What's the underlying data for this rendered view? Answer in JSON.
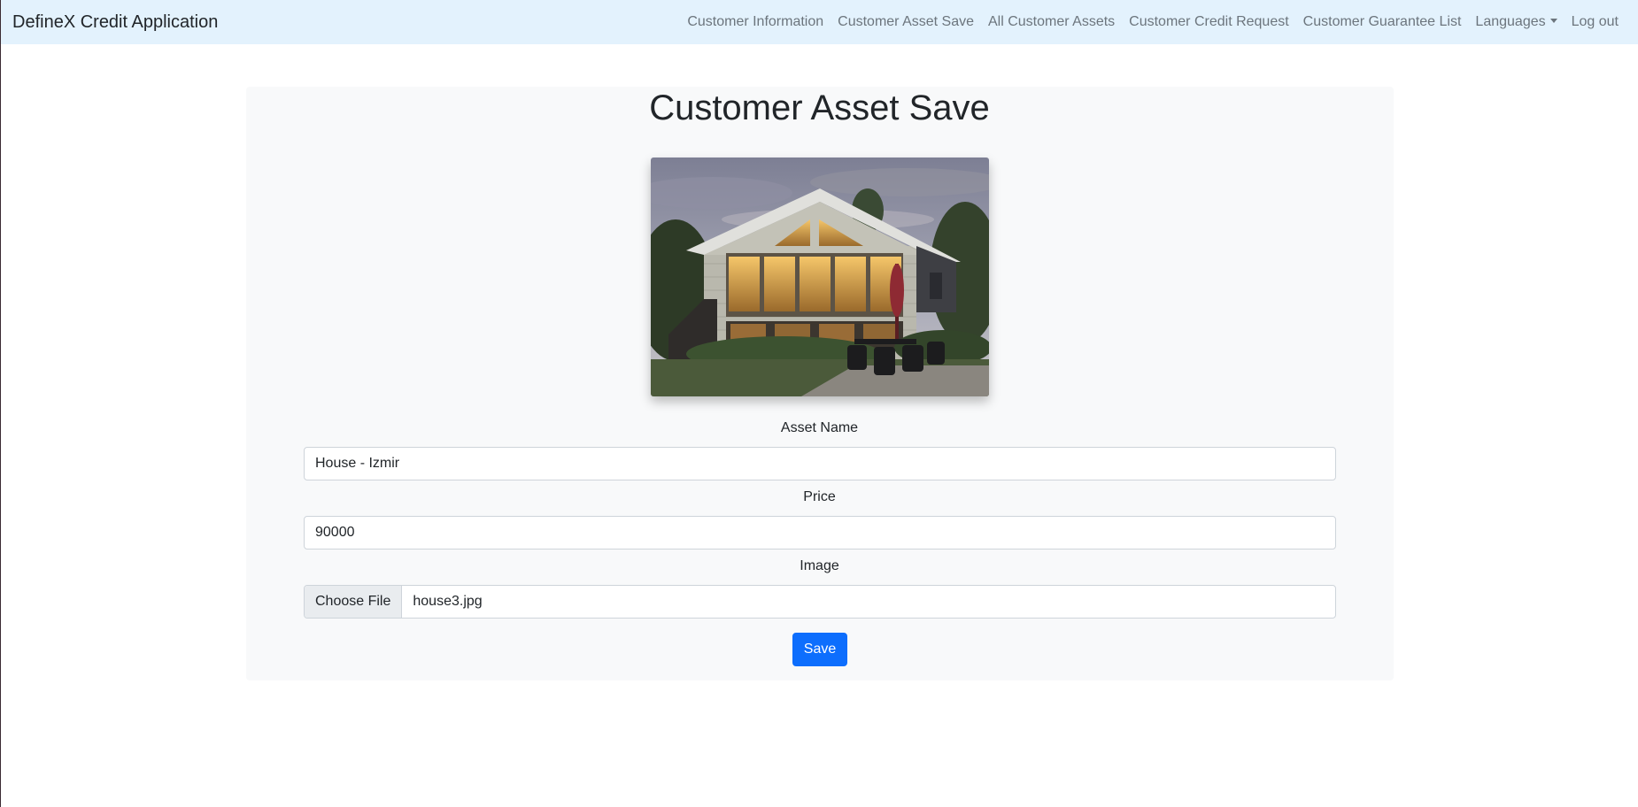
{
  "navbar": {
    "brand": "DefineX Credit Application",
    "links": [
      {
        "label": "Customer Information"
      },
      {
        "label": "Customer Asset Save"
      },
      {
        "label": "All Customer Assets"
      },
      {
        "label": "Customer Credit Request"
      },
      {
        "label": "Customer Guarantee List"
      },
      {
        "label": "Languages"
      },
      {
        "label": "Log out"
      }
    ]
  },
  "page": {
    "title": "Customer Asset Save",
    "image_subject": "house photo"
  },
  "form": {
    "asset_name": {
      "label": "Asset Name",
      "value": "House - Izmir"
    },
    "price": {
      "label": "Price",
      "value": "90000"
    },
    "image": {
      "label": "Image",
      "button": "Choose File",
      "file_name": "house3.jpg"
    },
    "save_label": "Save"
  },
  "colors": {
    "navbar_bg": "#e3f2fd",
    "card_bg": "#f8f9fa",
    "primary": "#0d6efd",
    "nav_link": "#6c757d"
  }
}
